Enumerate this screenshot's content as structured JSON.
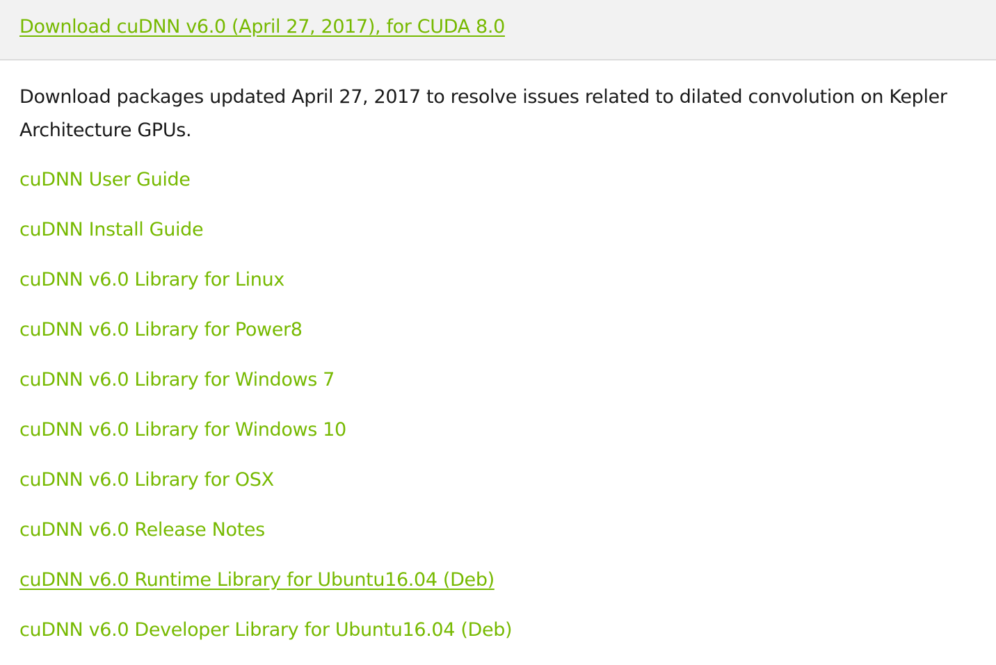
{
  "header": {
    "download_link": "Download cuDNN v6.0 (April 27, 2017), for CUDA 8.0"
  },
  "content": {
    "description": "Download packages updated April 27, 2017 to resolve issues related to dilated convolution on Kepler Architecture GPUs.",
    "links": [
      {
        "label": "cuDNN User Guide"
      },
      {
        "label": "cuDNN Install Guide"
      },
      {
        "label": "cuDNN v6.0 Library for Linux"
      },
      {
        "label": "cuDNN v6.0 Library for Power8"
      },
      {
        "label": "cuDNN v6.0 Library for Windows 7"
      },
      {
        "label": "cuDNN v6.0 Library for Windows 10"
      },
      {
        "label": "cuDNN v6.0 Library for OSX"
      },
      {
        "label": "cuDNN v6.0 Release Notes"
      },
      {
        "label": "cuDNN v6.0 Runtime Library for Ubuntu16.04 (Deb)",
        "hovered": true
      },
      {
        "label": "cuDNN v6.0 Developer Library for Ubuntu16.04 (Deb)"
      }
    ]
  },
  "colors": {
    "link": "#76b900",
    "text": "#1a1a1a",
    "header_background": "#f2f2f2"
  }
}
